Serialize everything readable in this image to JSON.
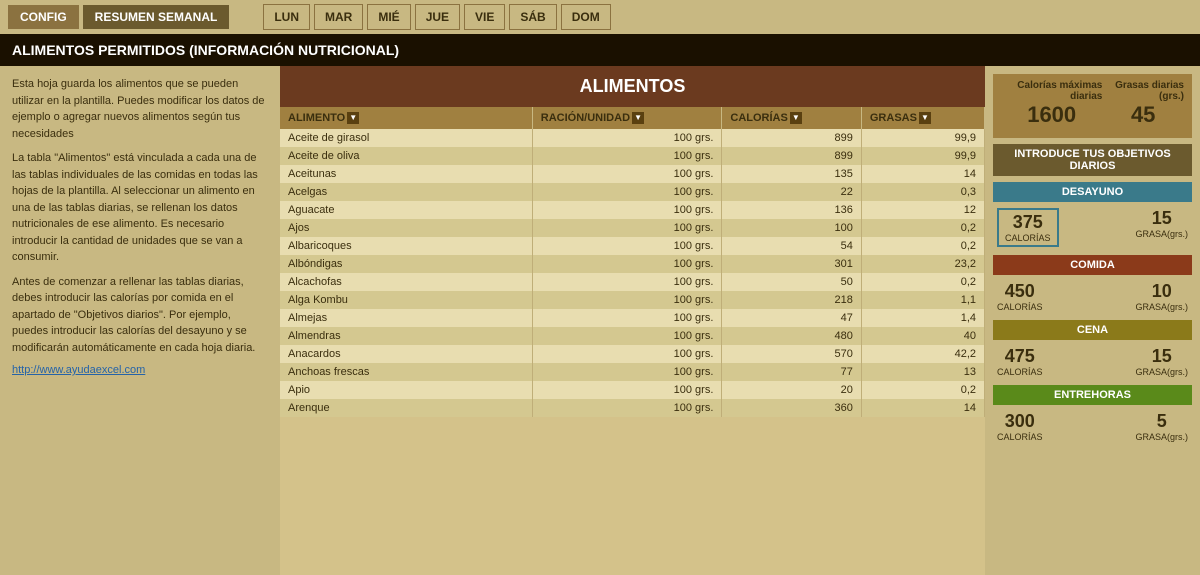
{
  "nav": {
    "config_label": "CONFIG",
    "resumen_label": "RESUMEN SEMANAL",
    "days": [
      "LUN",
      "MAR",
      "MIÉ",
      "JUE",
      "VIE",
      "SÁB",
      "DOM"
    ]
  },
  "page_title": "ALIMENTOS PERMITIDOS (INFORMACIÓN NUTRICIONAL)",
  "left_panel": {
    "text1": "Esta hoja guarda los alimentos que se pueden utilizar en la plantilla. Puedes modificar los datos de ejemplo o agregar nuevos alimentos según tus necesidades",
    "text2": "La tabla \"Alimentos\" está vinculada a cada una de las tablas individuales de las comidas en todas las hojas de la plantilla. Al seleccionar un alimento en una de las tablas diarias, se rellenan los datos nutricionales de ese alimento. Es necesario introducir la cantidad de unidades que se van a consumir.",
    "text3": "Antes de comenzar a rellenar las tablas diarias, debes introducir las calorías por comida en el apartado de \"Objetivos diarios\". Por ejemplo, puedes introducir las calorías del desayuno y se modificarán automáticamente en cada hoja diaria.",
    "link": "http://www.ayudaexcel.com"
  },
  "table": {
    "title": "ALIMENTOS",
    "headers": [
      "ALIMENTO",
      "RACIÓN/UNIDAD",
      "CALORÍAS",
      "GRASAS"
    ],
    "rows": [
      [
        "Aceite de girasol",
        "100 grs.",
        "899",
        "99,9"
      ],
      [
        "Aceite de oliva",
        "100 grs.",
        "899",
        "99,9"
      ],
      [
        "Aceitunas",
        "100 grs.",
        "135",
        "14"
      ],
      [
        "Acelgas",
        "100 grs.",
        "22",
        "0,3"
      ],
      [
        "Aguacate",
        "100 grs.",
        "136",
        "12"
      ],
      [
        "Ajos",
        "100 grs.",
        "100",
        "0,2"
      ],
      [
        "Albaricoques",
        "100 grs.",
        "54",
        "0,2"
      ],
      [
        "Albóndigas",
        "100 grs.",
        "301",
        "23,2"
      ],
      [
        "Alcachofas",
        "100 grs.",
        "50",
        "0,2"
      ],
      [
        "Alga Kombu",
        "100 grs.",
        "218",
        "1,1"
      ],
      [
        "Almejas",
        "100 grs.",
        "47",
        "1,4"
      ],
      [
        "Almendras",
        "100 grs.",
        "480",
        "40"
      ],
      [
        "Anacardos",
        "100 grs.",
        "570",
        "42,2"
      ],
      [
        "Anchoas frescas",
        "100 grs.",
        "77",
        "13"
      ],
      [
        "Apio",
        "100 grs.",
        "20",
        "0,2"
      ],
      [
        "Arenque",
        "100 grs.",
        "360",
        "14"
      ]
    ]
  },
  "right_panel": {
    "max_calories_label": "Calorías máximas diarias",
    "daily_fat_label": "Grasas diarias (grs.)",
    "max_calories_value": "1600",
    "daily_fat_value": "45",
    "objectives_title": "INTRODUCE TUS OBJETIVOS DIARIOS",
    "meals": [
      {
        "name": "DESAYUNO",
        "color": "desayuno-title",
        "calories": "375",
        "fat": "15",
        "calories_label": "CALORÍAS",
        "fat_label": "GRASA(grs.)"
      },
      {
        "name": "COMIDA",
        "color": "comida-title",
        "calories": "450",
        "fat": "10",
        "calories_label": "CALORÍAS",
        "fat_label": "GRASA(grs.)"
      },
      {
        "name": "CENA",
        "color": "cena-title",
        "calories": "475",
        "fat": "15",
        "calories_label": "CALORÍAS",
        "fat_label": "GRASA(grs.)"
      },
      {
        "name": "ENTREHORAS",
        "color": "entrehoras-title",
        "calories": "300",
        "fat": "5",
        "calories_label": "CALORÍAS",
        "fat_label": "GRASA(grs.)"
      }
    ]
  }
}
